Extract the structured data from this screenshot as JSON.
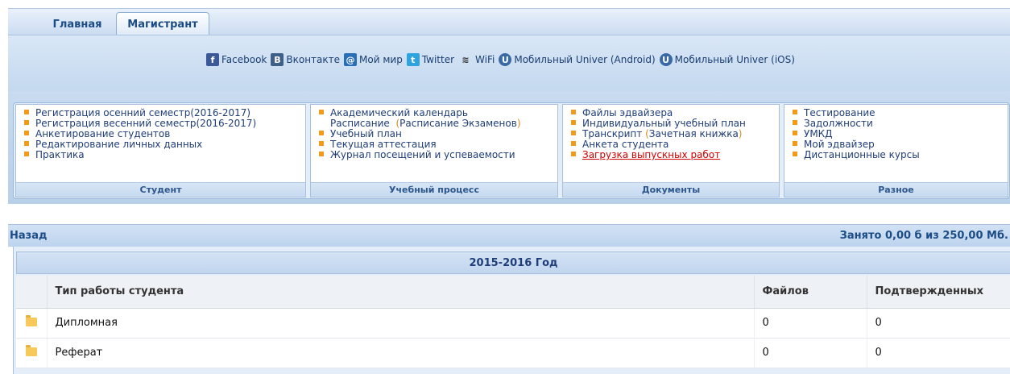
{
  "tabs": [
    {
      "label": "Главная",
      "active": false
    },
    {
      "label": "Магистрант",
      "active": true
    }
  ],
  "social_links": [
    {
      "icon": "facebook-icon",
      "glyph": "f",
      "label": "Facebook"
    },
    {
      "icon": "vkontakte-icon",
      "glyph": "B",
      "label": "Вконтакте"
    },
    {
      "icon": "moi-mir-icon",
      "glyph": "@",
      "label": "Мой мир"
    },
    {
      "icon": "twitter-icon",
      "glyph": "t",
      "label": "Twitter"
    },
    {
      "icon": "wifi-icon",
      "glyph": "≋",
      "label": "WiFi"
    },
    {
      "icon": "univer-android-icon",
      "glyph": "U",
      "label": "Мобильный Univer (Android)"
    },
    {
      "icon": "univer-ios-icon",
      "glyph": "U",
      "label": "Мобильный Univer (iOS)"
    }
  ],
  "menu": {
    "student": {
      "title": "Студент",
      "items": [
        "Регистрация осенний семестр(2016-2017)",
        "Регистрация весенний семестр(2016-2017)",
        "Анкетирование студентов",
        "Редактирование личных данных",
        "Практика"
      ]
    },
    "study": {
      "title": "Учебный процесс",
      "academic_calendar": "Академический календарь",
      "schedule": "Расписание",
      "exam_schedule": "Расписание Экзаменов",
      "study_plan": "Учебный план",
      "current_attestation": "Текущая аттестация",
      "journal": "Журнал посещений и успеваемости"
    },
    "documents": {
      "title": "Документы",
      "advisor_files": "Файлы эдвайзера",
      "individual_plan": "Индивидуальный учебный план",
      "transcript": "Транскрипт",
      "record_book": "Зачетная книжка",
      "student_form": "Анкета студента",
      "thesis_upload": "Загрузка выпускных работ",
      "thesis_upload_active": true
    },
    "misc": {
      "title": "Разное",
      "items": [
        "Тестирование",
        "Задолжности",
        "УМКД",
        "Мой эдвайзер",
        "Дистанционные курсы"
      ]
    }
  },
  "content": {
    "back_label": "Назад",
    "quota": "Занято 0,00 б из 250,00 Мб.",
    "year": "2015-2016 Год",
    "columns": [
      "Тип работы студента",
      "Файлов",
      "Подтвержденных"
    ],
    "rows": [
      {
        "type": "Дипломная",
        "files": "0",
        "confirmed": "0"
      },
      {
        "type": "Реферат",
        "files": "0",
        "confirmed": "0"
      }
    ]
  },
  "colors": {
    "link_blue": "#1f3d78",
    "bullet_orange": "#f39a1a",
    "active_link_red": "#d20000",
    "folder_yellow": "#f6c95a"
  }
}
